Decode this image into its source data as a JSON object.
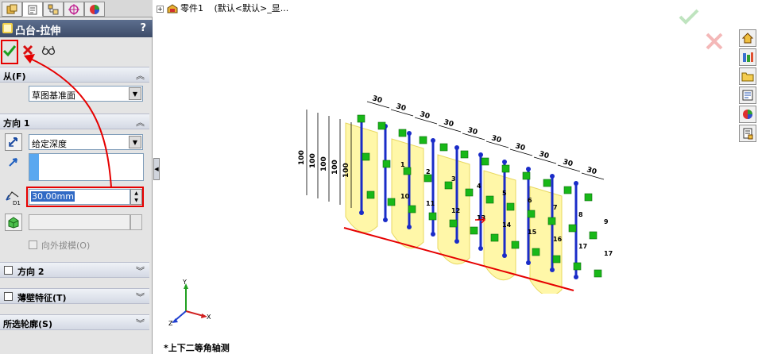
{
  "property_manager": {
    "title": "凸台-拉伸",
    "help": "?",
    "tabs": [
      "feature-manager-icon",
      "property-manager-icon",
      "configuration-manager-icon",
      "dim-xpert-icon",
      "display-manager-icon"
    ],
    "from": {
      "label": "从(F)",
      "value": "草图基准面"
    },
    "direction1": {
      "label": "方向 1",
      "end_condition": "给定深度",
      "depth": "30.00mm",
      "depth_icon_text": "D1",
      "draft_outward": "向外拔模(O)"
    },
    "direction2": {
      "label": "方向 2"
    },
    "thin_feature": {
      "label": "薄壁特征(T)"
    },
    "selected_contours": {
      "label": "所选轮廓(S)"
    }
  },
  "tree": {
    "part": "零件1",
    "config": "(默认<默认>_显..."
  },
  "view": {
    "name": "*上下二等角轴测",
    "triad": {
      "x": "X",
      "y": "Y",
      "z": "Z"
    }
  },
  "model": {
    "dims_top": [
      "30",
      "30",
      "30",
      "30",
      "30",
      "30",
      "30",
      "30",
      "30",
      "30"
    ],
    "dims_side": [
      "100",
      "100",
      "100",
      "100",
      "100"
    ],
    "point_labels": [
      "1",
      "2",
      "3",
      "4",
      "5",
      "6",
      "7",
      "8",
      "9",
      "10",
      "11",
      "12",
      "13",
      "14",
      "15",
      "16",
      "17",
      "17"
    ]
  },
  "colors": {
    "title_bar": "#3d4c68",
    "accent_red": "#e60000",
    "sketch_blue": "#1a2cc8",
    "relation_green": "#18b818",
    "preview_yellow": "#fff7a8"
  }
}
